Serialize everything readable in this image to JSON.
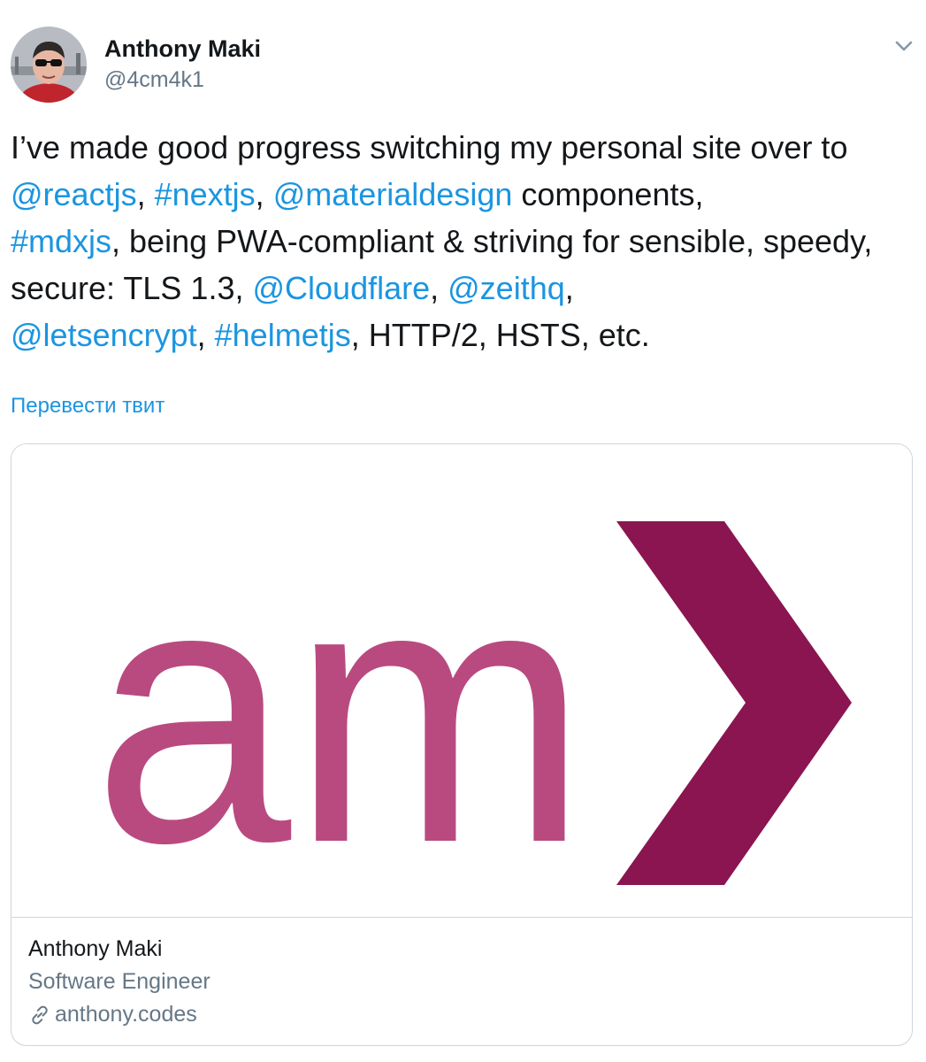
{
  "author": {
    "name": "Anthony Maki",
    "handle": "@4cm4k1"
  },
  "tweet": {
    "segments": [
      {
        "text": "I’ve made good progress switching my personal site over to ",
        "type": "text"
      },
      {
        "text": "@reactjs",
        "type": "link"
      },
      {
        "text": ", ",
        "type": "text"
      },
      {
        "text": "#nextjs",
        "type": "link"
      },
      {
        "text": ", ",
        "type": "text"
      },
      {
        "text": "@materialdesign",
        "type": "link"
      },
      {
        "text": " components, ",
        "type": "text"
      },
      {
        "text": "#mdxjs",
        "type": "link"
      },
      {
        "text": ", being PWA-compliant & striving for sensible, speedy, secure: TLS 1.3, ",
        "type": "text"
      },
      {
        "text": "@Cloudflare",
        "type": "link"
      },
      {
        "text": ", ",
        "type": "text"
      },
      {
        "text": "@zeithq",
        "type": "link"
      },
      {
        "text": ", ",
        "type": "text"
      },
      {
        "text": "@letsencrypt",
        "type": "link"
      },
      {
        "text": ", ",
        "type": "text"
      },
      {
        "text": "#helmetjs",
        "type": "link"
      },
      {
        "text": ", HTTP/2, HSTS, etc.",
        "type": "text"
      }
    ],
    "translate_label": "Перевести твит"
  },
  "card": {
    "logo_text": "am",
    "title": "Anthony Maki",
    "description": "Software Engineer",
    "domain": "anthony.codes",
    "colors": {
      "logo_letters": "#b94a80",
      "logo_chevron": "#8a1550"
    }
  },
  "icons": {
    "menu": "chevron-down-icon",
    "link": "link-icon"
  },
  "colors": {
    "link": "#1b95e0",
    "text": "#14171a",
    "secondary": "#657786",
    "border": "#ccd6dd"
  }
}
